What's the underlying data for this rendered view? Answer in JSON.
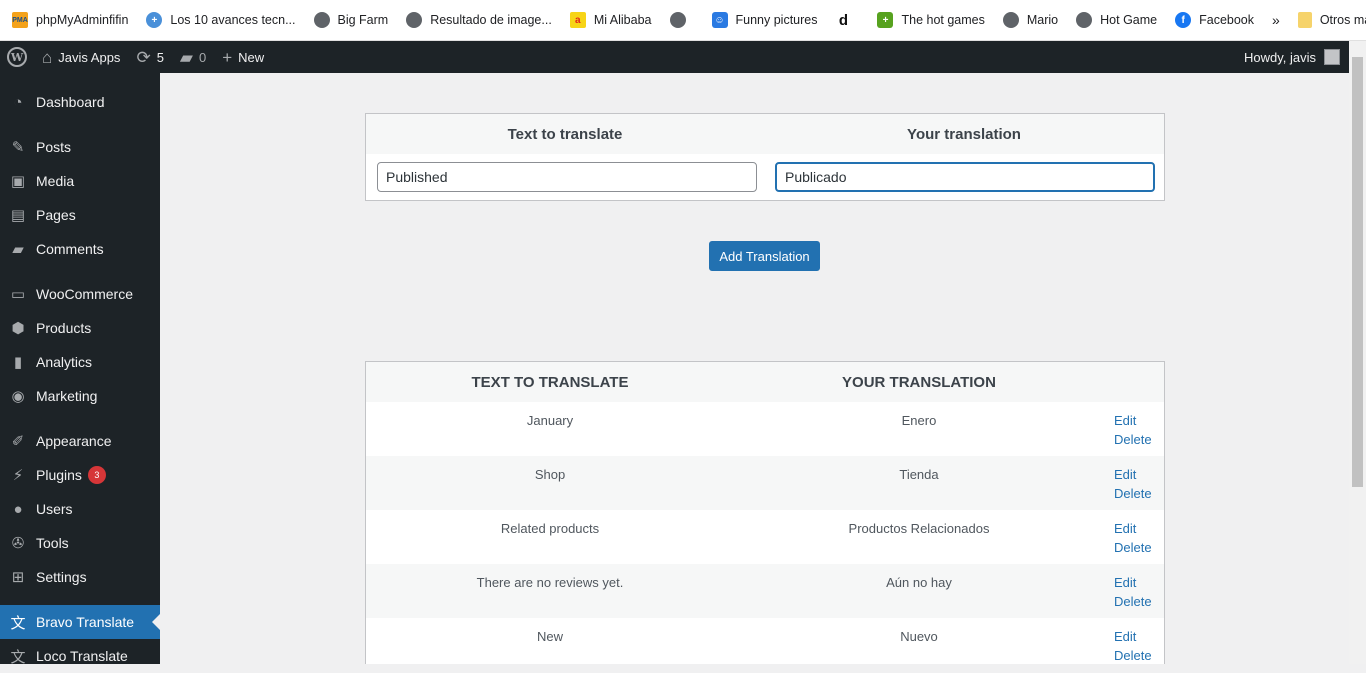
{
  "bookmarks": [
    {
      "label": "phpMyAdminfifin",
      "icon": "pma-icon"
    },
    {
      "label": "Los 10 avances tecn...",
      "icon": "site-icon"
    },
    {
      "label": "Big Farm",
      "icon": "globe-icon"
    },
    {
      "label": "Resultado de image...",
      "icon": "globe-icon"
    },
    {
      "label": "Mi Alibaba",
      "icon": "alibaba-icon"
    },
    {
      "label": "",
      "icon": "globe-icon"
    },
    {
      "label": "Funny pictures",
      "icon": "funny-icon"
    },
    {
      "label": "",
      "icon": "d-icon"
    },
    {
      "label": "The hot games",
      "icon": "games-icon"
    },
    {
      "label": "Mario",
      "icon": "globe-icon"
    },
    {
      "label": "Hot Game",
      "icon": "globe-icon"
    },
    {
      "label": "Facebook",
      "icon": "facebook-icon"
    }
  ],
  "bookmarks_more": "»",
  "other_bookmarks": "Otros marcadores",
  "adminbar": {
    "site_name": "Javis Apps",
    "updates": "5",
    "comments": "0",
    "new_label": "New",
    "howdy": "Howdy, javis"
  },
  "sidebar": {
    "items": [
      {
        "label": "Dashboard",
        "icon": "dashboard-icon"
      },
      {
        "label": "Posts",
        "icon": "pin-icon"
      },
      {
        "label": "Media",
        "icon": "media-icon"
      },
      {
        "label": "Pages",
        "icon": "pages-icon"
      },
      {
        "label": "Comments",
        "icon": "comments-icon"
      },
      {
        "label": "WooCommerce",
        "icon": "woo-icon"
      },
      {
        "label": "Products",
        "icon": "products-icon"
      },
      {
        "label": "Analytics",
        "icon": "analytics-icon"
      },
      {
        "label": "Marketing",
        "icon": "marketing-icon"
      },
      {
        "label": "Appearance",
        "icon": "brush-icon"
      },
      {
        "label": "Plugins",
        "icon": "plug-icon",
        "badge": "3"
      },
      {
        "label": "Users",
        "icon": "users-icon"
      },
      {
        "label": "Tools",
        "icon": "wrench-icon"
      },
      {
        "label": "Settings",
        "icon": "settings-icon"
      },
      {
        "label": "Bravo Translate",
        "icon": "translate-icon",
        "active": true
      },
      {
        "label": "Loco Translate",
        "icon": "translate-icon"
      }
    ]
  },
  "form": {
    "col_text": "Text to translate",
    "col_translation": "Your translation",
    "text_value": "Published",
    "translation_value": "Publicado",
    "add_button": "Add Translation"
  },
  "table": {
    "col_text": "TEXT TO TRANSLATE",
    "col_translation": "YOUR TRANSLATION",
    "edit_label": "Edit",
    "delete_label": "Delete",
    "rows": [
      {
        "text": "January",
        "translation": "Enero"
      },
      {
        "text": "Shop",
        "translation": "Tienda"
      },
      {
        "text": "Related products",
        "translation": "Productos Relacionados"
      },
      {
        "text": "There are no reviews yet.",
        "translation": "Aún no hay"
      },
      {
        "text": "New",
        "translation": "Nuevo"
      }
    ]
  },
  "colors": {
    "accent": "#2271b1",
    "sidebar": "#1d2327",
    "badge": "#d63638"
  }
}
